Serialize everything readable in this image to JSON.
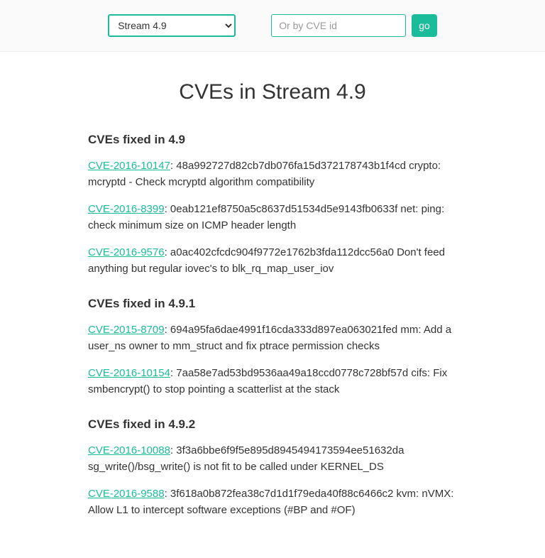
{
  "header": {
    "stream_select": {
      "value": "Stream 4.9"
    },
    "search": {
      "placeholder": "Or by CVE id"
    },
    "go_label": "go"
  },
  "page_title": "CVEs in Stream 4.9",
  "sections": [
    {
      "heading": "CVEs fixed in 4.9",
      "entries": [
        {
          "cve": "CVE-2016-10147",
          "text": ": 48a992727d82cb7db076fa15d372178743b1f4cd crypto: mcryptd - Check mcryptd algorithm compatibility"
        },
        {
          "cve": "CVE-2016-8399",
          "text": ": 0eab121ef8750a5c8637d51534d5e9143fb0633f net: ping: check minimum size on ICMP header length"
        },
        {
          "cve": "CVE-2016-9576",
          "text": ": a0ac402cfcdc904f9772e1762b3fda112dcc56a0 Don't feed anything but regular iovec's to blk_rq_map_user_iov"
        }
      ]
    },
    {
      "heading": "CVEs fixed in 4.9.1",
      "entries": [
        {
          "cve": "CVE-2015-8709",
          "text": ": 694a95fa6dae4991f16cda333d897ea063021fed mm: Add a user_ns owner to mm_struct and fix ptrace permission checks"
        },
        {
          "cve": "CVE-2016-10154",
          "text": ": 7aa58e7ad53bd9536aa49a18ccd0778c728bf57d cifs: Fix smbencrypt() to stop pointing a scatterlist at the stack"
        }
      ]
    },
    {
      "heading": "CVEs fixed in 4.9.2",
      "entries": [
        {
          "cve": "CVE-2016-10088",
          "text": ": 3f3a6bbe6f9f5e895d8945494173594ee51632da sg_write()/bsg_write() is not fit to be called under KERNEL_DS"
        },
        {
          "cve": "CVE-2016-9588",
          "text": ": 3f618a0b872fea38c7d1d1f79eda40f88c6466c2 kvm: nVMX: Allow L1 to intercept software exceptions (#BP and #OF)"
        }
      ]
    }
  ]
}
